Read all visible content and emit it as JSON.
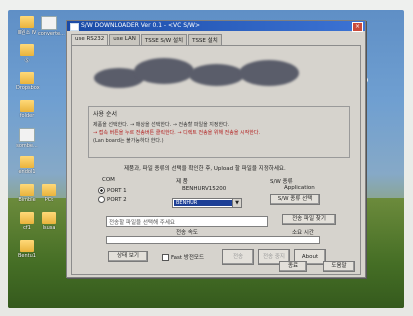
{
  "desktop": {
    "icons": [
      {
        "label": "Ⅲ원소 Ⅳ",
        "type": "folder"
      },
      {
        "label": "converte...",
        "type": "doc"
      },
      {
        "label": "Ⓢ",
        "type": "folder"
      },
      {
        "label": "Dropsbox",
        "type": "folder"
      },
      {
        "label": "folder",
        "type": "folder"
      },
      {
        "label": "sombe...",
        "type": "doc"
      },
      {
        "label": "endol1",
        "type": "folder"
      },
      {
        "label": "PCt",
        "type": "folder"
      },
      {
        "label": "Bimble",
        "type": "folder"
      },
      {
        "label": "cf1",
        "type": "folder"
      },
      {
        "label": "Isusa",
        "type": "folder"
      },
      {
        "label": "Bentu1",
        "type": "folder"
      }
    ]
  },
  "window": {
    "title": "S/W DOWNLOADER Ver 0.1 - <VC S/W>",
    "close_glyph": "×"
  },
  "tabs": [
    {
      "label": "use RS232",
      "active": true
    },
    {
      "label": "use LAN",
      "active": false
    },
    {
      "label": "TSSE S/W 설치",
      "active": false
    },
    {
      "label": "TSSE 설치",
      "active": false
    }
  ],
  "notice": {
    "title": "사용 순서",
    "lines": [
      {
        "text": "제품을 선택한다. → 매상을 선택한다. → 전송할 파일을 지정한다.",
        "red": false
      },
      {
        "text": "→ 접속 버튼을 누르 전송버튼 클릭한다. → 디렉트 전송을 위해 전송을 시작한다.",
        "red": true
      },
      {
        "text": "(Lan board는 불가능하다 한다.)",
        "red": false
      }
    ]
  },
  "guide_text": "제품과, 파일 종류의 선택을 확인한 후, Upload 할 파일을 지정하세요.",
  "com": {
    "title": "COM",
    "port1": "PORT 1",
    "port2": "PORT 2",
    "selected": "PORT 1"
  },
  "product": {
    "title": "제 품",
    "model": "BENHURV15200",
    "selected": "BENHUR"
  },
  "sw_type": {
    "title": "S/W 종류",
    "value": "Application",
    "button": "S/W 종류 선택"
  },
  "file": {
    "placeholder": "전송할 파일을 선택해 주세요",
    "select_button": "전송 파일 찾기",
    "speed_label": "전송 속도",
    "time_label": "소요 시간"
  },
  "controls": {
    "state_button": "상태 보기",
    "check_label": "Fast 방전모드",
    "send_button": "전송",
    "stop_button": "전송 중지",
    "about_button": "About",
    "exit_button": "종료",
    "help_button": "도움말"
  }
}
